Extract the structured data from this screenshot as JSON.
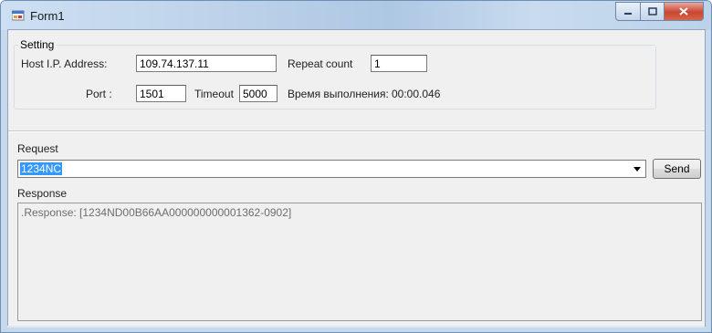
{
  "window": {
    "title": "Form1",
    "icon": "form-app-icon",
    "controls": [
      "minimize-icon",
      "maximize-icon",
      "close-icon"
    ]
  },
  "setting": {
    "group_label": "Setting",
    "host_label": "Host I.P. Address:",
    "host_value": "109.74.137.11",
    "port_label": "Port :",
    "port_value": "1501",
    "timeout_label": "Timeout",
    "timeout_value": "5000",
    "repeat_label": "Repeat count",
    "repeat_value": "1",
    "exec_time_label": "Время выполнения:",
    "exec_time_value": "00:00.046"
  },
  "request": {
    "label": "Request",
    "value": "1234NC",
    "send_label": "Send"
  },
  "response": {
    "label": "Response",
    "text": ".Response: [1234ND00B66AA000000000001362-0902]"
  },
  "colors": {
    "selection": "#3399ff",
    "close_button": "#c8462f"
  }
}
